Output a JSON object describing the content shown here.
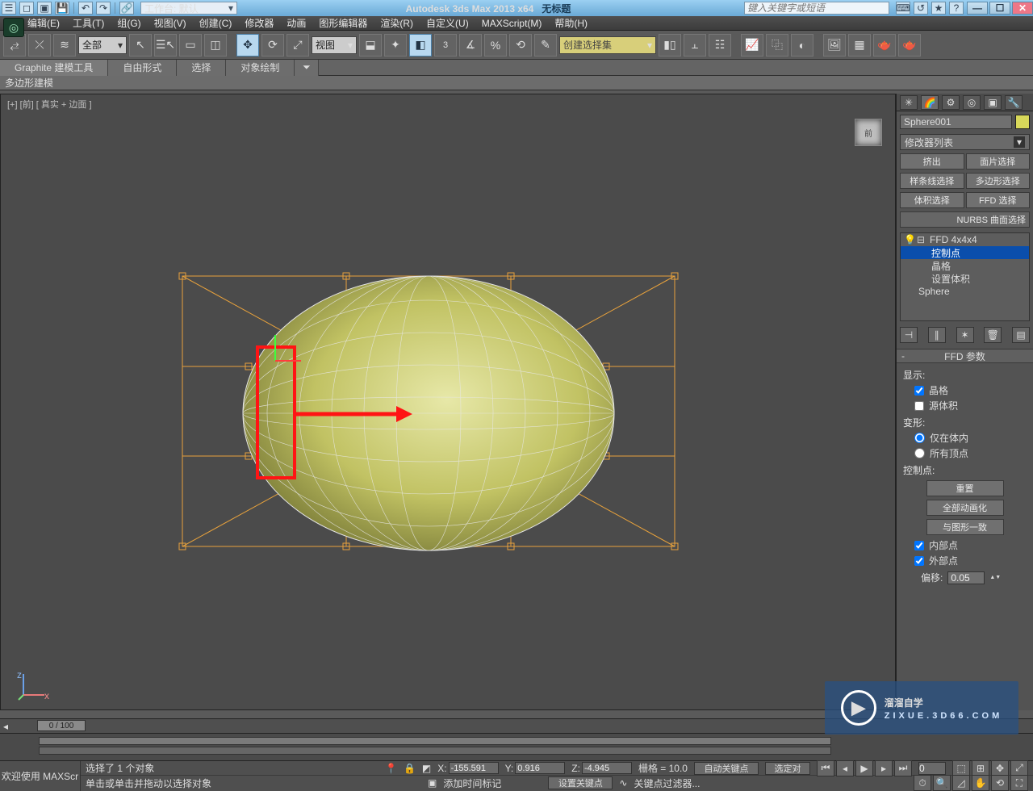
{
  "titlebar": {
    "workspace_label": "工作台: 默认",
    "app_title": "Autodesk 3ds Max  2013 x64",
    "doc_title": "无标题",
    "search_placeholder": "键入关键字或短语"
  },
  "menu": [
    "编辑(E)",
    "工具(T)",
    "组(G)",
    "视图(V)",
    "创建(C)",
    "修改器",
    "动画",
    "图形编辑器",
    "渲染(R)",
    "自定义(U)",
    "MAXScript(M)",
    "帮助(H)"
  ],
  "maintoolbar": {
    "all": "全部",
    "viewdrop": "视图",
    "selset": "创建选择集"
  },
  "ribbon": {
    "tabs": [
      "Graphite 建模工具",
      "自由形式",
      "选择",
      "对象绘制"
    ],
    "sub": "多边形建模"
  },
  "viewport": {
    "label": "[+] [前] [ 真实 + 边面 ]",
    "cube": "前"
  },
  "rpanel": {
    "objname": "Sphere001",
    "modlist": "修改器列表",
    "btns": {
      "extrude": "挤出",
      "faceSel": "面片选择",
      "splineSel": "样条线选择",
      "polySel": "多边形选择",
      "volSel": "体积选择",
      "ffdSel": "FFD 选择",
      "nurbs": "NURBS 曲面选择"
    },
    "stack": {
      "ffd": "FFD 4x4x4",
      "cp": "控制点",
      "lat": "晶格",
      "setVol": "设置体积",
      "sphere": "Sphere"
    },
    "roll": "FFD 参数",
    "display": "显示:",
    "lattice": "晶格",
    "srcvol": "源体积",
    "deform": "变形:",
    "inonly": "仅在体内",
    "allvert": "所有顶点",
    "ctrl": "控制点:",
    "reset": "重置",
    "animall": "全部动画化",
    "matchshape": "与图形一致",
    "inner": "内部点",
    "outer": "外部点",
    "offset_label": "偏移:",
    "offset_val": "0.05"
  },
  "timeline": {
    "pos": "0 / 100"
  },
  "status": {
    "welcome": "欢迎使用 MAXScr",
    "sel": "选择了 1 个对象",
    "hint": "单击或单击并拖动以选择对象",
    "x": "-155.591",
    "y": "0.916",
    "z": "-4.945",
    "grid": "栅格 = 10.0",
    "autokey": "自动关键点",
    "setkey": "设置关键点",
    "keyfilt": "关键点过滤器...",
    "addtm": "添加时间标记",
    "seldef": "选定对"
  },
  "watermark": {
    "brand": "溜溜自学",
    "url": "ZIXUE.3D66.COM"
  }
}
